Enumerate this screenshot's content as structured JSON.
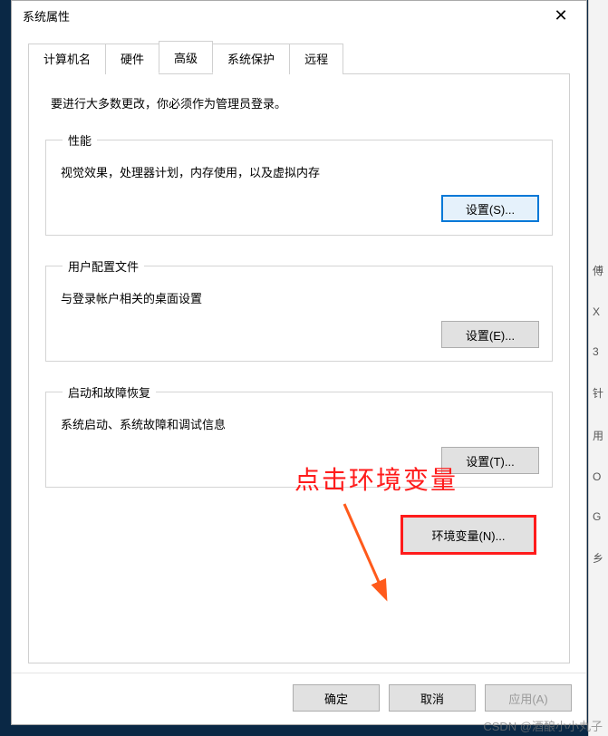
{
  "window": {
    "title": "系统属性",
    "close_glyph": "✕"
  },
  "tabs": {
    "computer_name": "计算机名",
    "hardware": "硬件",
    "advanced": "高级",
    "system_protection": "系统保护",
    "remote": "远程"
  },
  "intro": "要进行大多数更改，你必须作为管理员登录。",
  "perf": {
    "legend": "性能",
    "desc": "视觉效果，处理器计划，内存使用，以及虚拟内存",
    "button": "设置(S)..."
  },
  "profiles": {
    "legend": "用户配置文件",
    "desc": "与登录帐户相关的桌面设置",
    "button": "设置(E)..."
  },
  "startup": {
    "legend": "启动和故障恢复",
    "desc": "系统启动、系统故障和调试信息",
    "button": "设置(T)..."
  },
  "env_button": "环境变量(N)...",
  "footer": {
    "ok": "确定",
    "cancel": "取消",
    "apply": "应用(A)"
  },
  "annotation": "点击环境变量",
  "watermark": "CSDN @酒酿小小丸子",
  "side": {
    "a": "傅",
    "b": "X",
    "c": "3",
    "d": "针",
    "e": "用",
    "f": "O",
    "g": "G",
    "h": "乡"
  }
}
